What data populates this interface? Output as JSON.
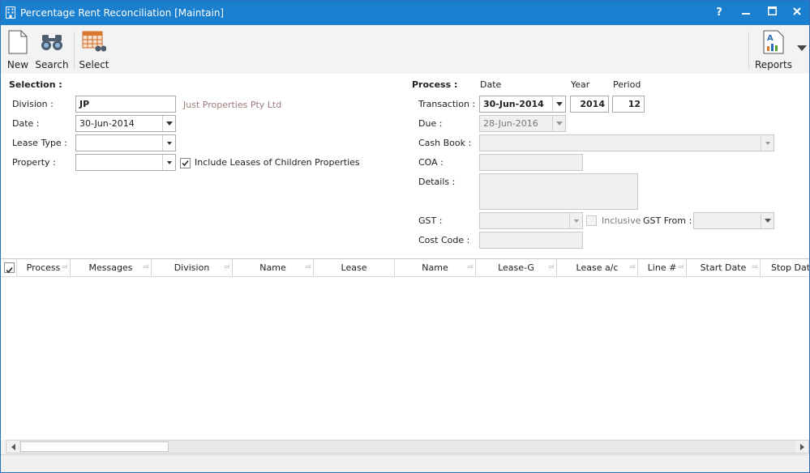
{
  "window": {
    "title": "Percentage Rent Reconciliation [Maintain]",
    "controls": {
      "help": "?",
      "minimize": "—",
      "maximize": "☐",
      "close": "✕"
    }
  },
  "toolbar": {
    "new_label": "New",
    "search_label": "Search",
    "select_label": "Select",
    "reports_label": "Reports"
  },
  "selection": {
    "header": "Selection :",
    "division_label": "Division :",
    "division_value": "JP",
    "division_name": "Just Properties Pty Ltd",
    "date_label": "Date :",
    "date_value": "30-Jun-2014",
    "lease_type_label": "Lease Type :",
    "lease_type_value": "",
    "property_label": "Property :",
    "property_value": "",
    "include_children_label": "Include Leases of Children Properties",
    "include_children_checked": true
  },
  "process": {
    "header": "Process :",
    "col_date": "Date",
    "col_year": "Year",
    "col_period": "Period",
    "transaction_label": "Transaction :",
    "transaction_date": "30-Jun-2014",
    "transaction_year": "2014",
    "transaction_period": "12",
    "due_label": "Due :",
    "due_date": "28-Jun-2016",
    "cash_book_label": "Cash Book :",
    "cash_book_value": "",
    "coa_label": "COA :",
    "coa_value": "",
    "details_label": "Details :",
    "details_value": "",
    "gst_label": "GST :",
    "gst_value": "",
    "inclusive_label": "Inclusive",
    "gst_from_label": "GST From :",
    "gst_from_value": "",
    "cost_code_label": "Cost Code :",
    "cost_code_value": ""
  },
  "grid": {
    "columns": [
      "Process",
      "Messages",
      "Division",
      "Name",
      "Lease",
      "Name",
      "Lease-G",
      "Lease a/c",
      "Line #",
      "Start Date",
      "Stop Date"
    ],
    "rows": []
  },
  "colors": {
    "titlebar": "#1b7fd0",
    "accent": "#1b7fd0"
  }
}
